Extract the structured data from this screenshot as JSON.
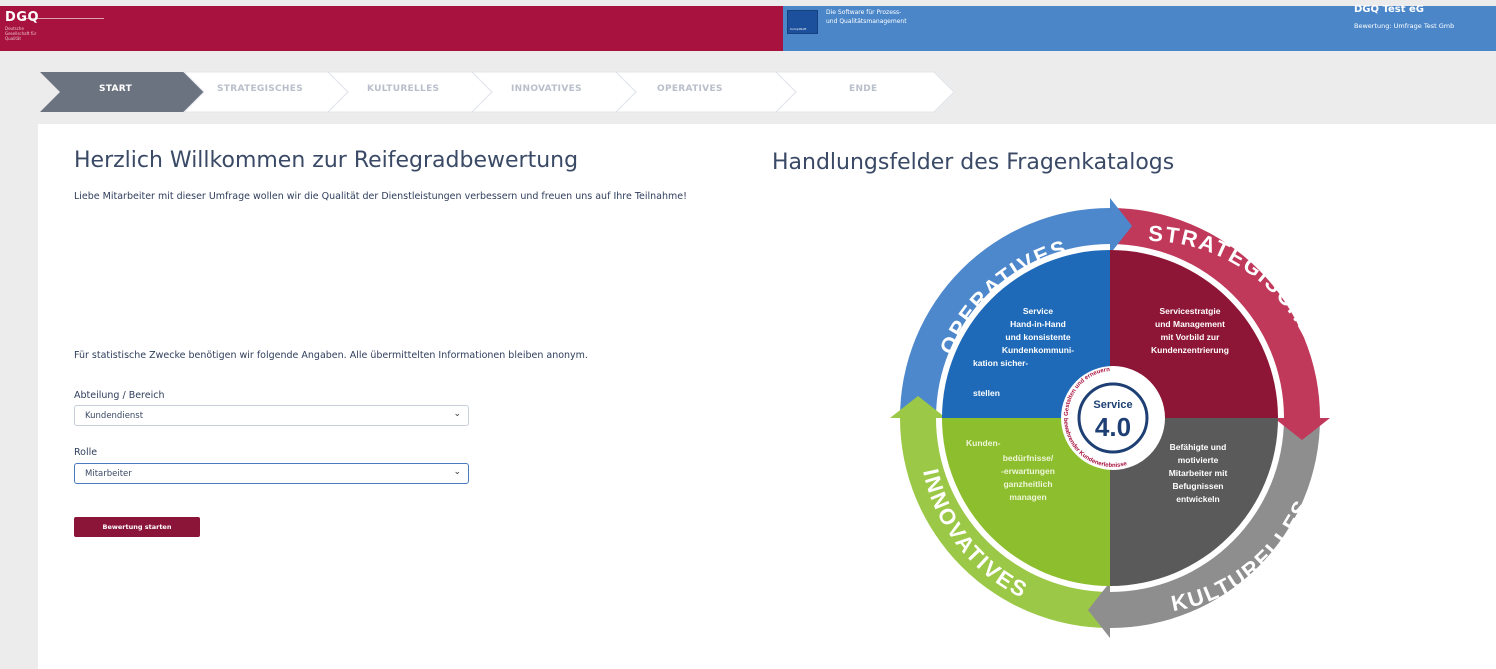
{
  "header": {
    "logo": "DGQ",
    "logo_sub": "Deutsche Gesellschaft für Qualität",
    "product_logo": "CompliSoft",
    "product_tagline": [
      "Die Software für Prozess-",
      "und Qualitätsmanagement"
    ],
    "org_name": "DGQ Test eG",
    "org_sub": "Bewertung: Umfrage Test Gmb"
  },
  "steps": [
    "START",
    "STRATEGISCHES",
    "KULTURELLES",
    "INNOVATIVES",
    "OPERATIVES",
    "ENDE"
  ],
  "active_step": 0,
  "colors": {
    "brand_red": "#a8123e",
    "brand_blue": "#4a86c8",
    "strategisches": "#c0385a",
    "operatives": "#4e88cc",
    "innovatives": "#9cc847",
    "kulturelles": "#8e8e8e",
    "button": "#8a1538"
  },
  "main": {
    "title": "Herzlich Willkommen zur Reifegradbewertung",
    "intro": "Liebe Mitarbeiter mit dieser Umfrage wollen wir die Qualität der Dienstleistungen verbessern und freuen uns auf Ihre Teilnahme!",
    "stat_note": "Für statistische Zwecke benötigen wir folgende Angaben. Alle übermittelten Informationen bleiben anonym.",
    "field1_label": "Abteilung / Bereich",
    "field1_value": "Kundendienst",
    "field2_label": "Rolle",
    "field2_value": "Mitarbeiter",
    "start_button": "Bewertung starten"
  },
  "diagram": {
    "title": "Handlungsfelder des Fragenkatalogs",
    "ring_labels": {
      "operatives": "OPERATIVES",
      "strategisches": "STRATEGISCHES",
      "kulturelles": "KULTURELLES",
      "innovatives": "INNOVATIVES"
    },
    "quadrants": {
      "operatives": [
        "Service",
        "Hand-in-Hand",
        "und konsistente",
        "Kundenkommuni-",
        "kation sicher-",
        "stellen"
      ],
      "strategisches": [
        "Servicestratgie",
        "und Management",
        "mit Vorbild zur",
        "Kundenzentrierung"
      ],
      "innovatives": [
        "Kunden-",
        "bedürfnisse/",
        "-erwartungen",
        "ganzheitlich",
        "managen"
      ],
      "kulturelles": [
        "Befähigte und",
        "motivierte",
        "Mitarbeiter mit",
        "Befugnissen",
        "entwickeln"
      ]
    },
    "center": {
      "word": "Service",
      "version": "4.0",
      "arc_top": "Gestalten und erneuern",
      "arc_bottom": "bewahrender Kundenerlebnisse"
    }
  }
}
